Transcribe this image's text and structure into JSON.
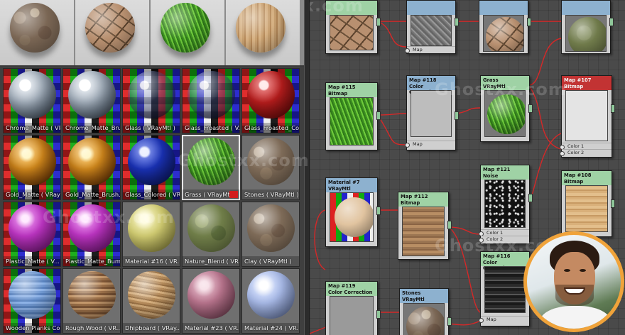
{
  "watermark": "Ghostxx.com",
  "preview_strip": [
    {
      "name": "stone-pebble-preview",
      "texture": "tx-rock"
    },
    {
      "name": "cracked-mud-preview",
      "texture": "tx-cracked"
    },
    {
      "name": "grass-preview",
      "texture": "tx-grass"
    },
    {
      "name": "wood-preview",
      "texture": "tx-wood"
    }
  ],
  "material_slots": [
    {
      "label": "Chrome_Matte  ( VRayMtl )",
      "sphere": "chrome",
      "bg": "checker"
    },
    {
      "label": "Chrome_Matte_Bru...",
      "sphere": "chrome",
      "bg": "checker"
    },
    {
      "label": "Glass  ( VRayMtl )",
      "sphere": "glass",
      "bg": "checker"
    },
    {
      "label": "Glass_Froasted  ( V...",
      "sphere": "glass",
      "bg": "checker"
    },
    {
      "label": "Glass_Froasted_Col...",
      "sphere": "redglass",
      "bg": "checker"
    },
    {
      "label": "Gold_Matte  ( VRayM...",
      "sphere": "gold",
      "bg": "checker"
    },
    {
      "label": "Gold_Matte_Brush...",
      "sphere": "gold",
      "bg": "checker"
    },
    {
      "label": "Glass_Colored  ( VR...",
      "sphere": "blueglass",
      "bg": "checker"
    },
    {
      "label": "Grass  ( VRayMtl )",
      "sphere": "grass",
      "bg": "plain",
      "selected": true,
      "tag": true
    },
    {
      "label": "Stones  ( VRayMtl )",
      "sphere": "stones",
      "bg": "plain"
    },
    {
      "label": "Plastic_Matte  ( V...",
      "sphere": "plastic",
      "bg": "checker"
    },
    {
      "label": "Plastic_Matte_Bum...",
      "sphere": "plastic",
      "bg": "checker"
    },
    {
      "label": "Material #16  ( VR...",
      "sphere": "yellow",
      "bg": "plain"
    },
    {
      "label": "Nature_Blend  ( VR...",
      "sphere": "nature",
      "bg": "plain"
    },
    {
      "label": "Clay  ( VRayMtl )",
      "sphere": "stones",
      "bg": "plain"
    },
    {
      "label": "Wooden Planks Col...",
      "sphere": "bluewood",
      "bg": "checker"
    },
    {
      "label": "Rough Wood  ( VR...",
      "sphere": "roughwood",
      "bg": "plain"
    },
    {
      "label": "Dhipboard  ( VRay...",
      "sphere": "chipboard",
      "bg": "plain"
    },
    {
      "label": "Material #23  ( VR...",
      "sphere": "pink",
      "bg": "plain"
    },
    {
      "label": "Material #24  ( VR...",
      "sphere": "lightblue",
      "bg": "plain"
    }
  ],
  "nodes": {
    "n_top_bitmap": {
      "title": ""
    },
    "n_top_cc": {
      "title": "",
      "port": "Map"
    },
    "n_top_mtl": {
      "title": ""
    },
    "n_top_mtl2": {
      "title": ""
    },
    "n_map115": {
      "title": "Map #115",
      "subtitle": "Bitmap"
    },
    "n_map118": {
      "title": "Map #118",
      "subtitle": "Color Correction",
      "port": "Map"
    },
    "n_grass": {
      "title": "Grass",
      "subtitle": "VRayMtl"
    },
    "n_map107": {
      "title": "Map #107",
      "subtitle": "Bitmap",
      "port1": "Color 1",
      "port2": "Color 2"
    },
    "n_map121": {
      "title": "Map #121",
      "subtitle": "Noise",
      "port1": "Color 1",
      "port2": "Color 2"
    },
    "n_map108": {
      "title": "Map #108",
      "subtitle": "Bitmap"
    },
    "n_material7": {
      "title": "Material #7",
      "subtitle": "VRayMtl"
    },
    "n_map112": {
      "title": "Map #112",
      "subtitle": "Bitmap"
    },
    "n_map116": {
      "title": "Map #116",
      "subtitle": "Color Correction",
      "port": "Map"
    },
    "n_map119": {
      "title": "Map #119",
      "subtitle": "Color Correction"
    },
    "n_stones": {
      "title": "Stones",
      "subtitle": "VRayMtl"
    }
  }
}
